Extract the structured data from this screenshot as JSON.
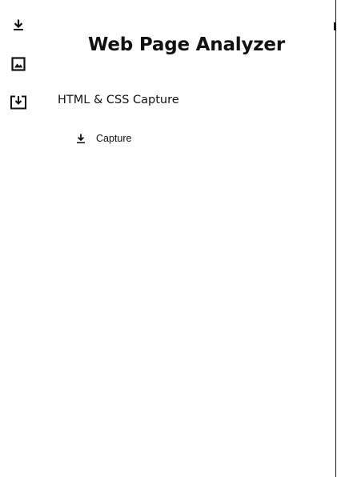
{
  "app": {
    "title": "Web Page Analyzer"
  },
  "rail": {
    "items": [
      {
        "icon": "download-icon"
      },
      {
        "icon": "image-icon"
      },
      {
        "icon": "save-to-device-icon"
      }
    ]
  },
  "section": {
    "title": "HTML & CSS Capture"
  },
  "actions": {
    "capture_label": "Capture",
    "capture_icon": "download-icon"
  },
  "colors": {
    "text": "#111111",
    "background": "#ffffff"
  }
}
